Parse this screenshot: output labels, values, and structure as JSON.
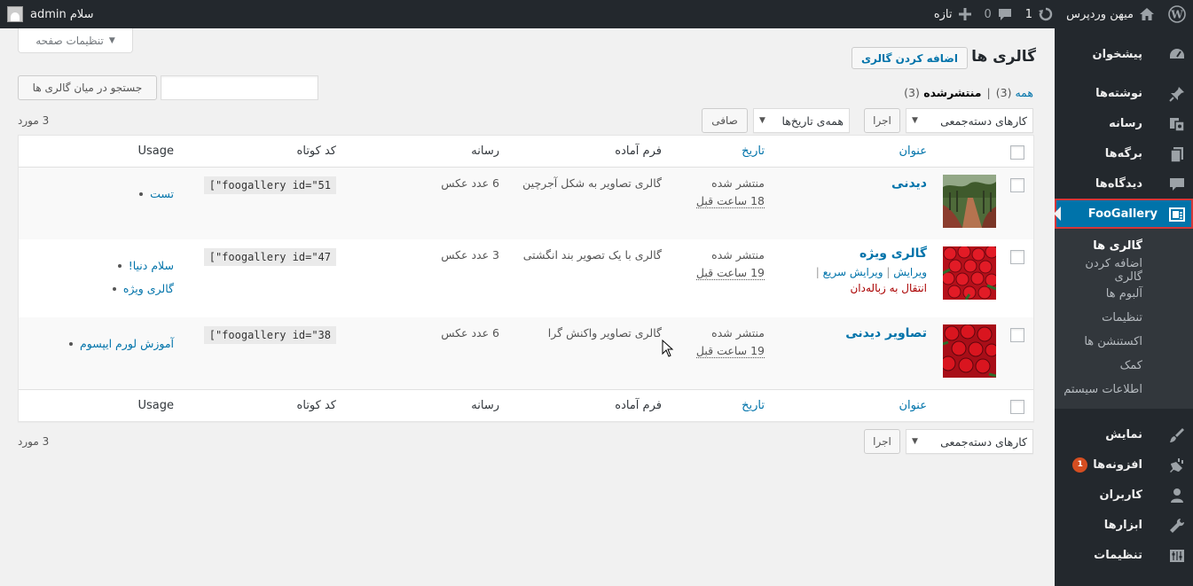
{
  "adminbar": {
    "site_name": "میهن وردپرس",
    "updates_count": "1",
    "comments_count": "0",
    "new_label": "تازه",
    "howdy": "سلام admin"
  },
  "sidebar": {
    "items_top": [
      {
        "label": "پیشخوان",
        "icon": "dashboard-icon"
      }
    ],
    "items": [
      {
        "label": "نوشته‌ها",
        "icon": "pin-icon"
      },
      {
        "label": "رسانه",
        "icon": "media-icon"
      },
      {
        "label": "برگه‌ها",
        "icon": "page-icon"
      },
      {
        "label": "دیدگاه‌ها",
        "icon": "comment-icon"
      }
    ],
    "current": {
      "label": "FooGallery",
      "icon": "gallery-icon"
    },
    "submenu": [
      "گالری ها",
      "اضافه کردن گالری",
      "آلبوم ها",
      "تنظیمات",
      "اکستنشن ها",
      "کمک",
      "اطلاعات سیستم"
    ],
    "items_bottom": [
      {
        "label": "نمایش",
        "icon": "brush-icon"
      },
      {
        "label": "افزونه‌ها",
        "icon": "plugin-icon",
        "badge": "1"
      },
      {
        "label": "کاربران",
        "icon": "users-icon"
      },
      {
        "label": "ابزارها",
        "icon": "tools-icon"
      },
      {
        "label": "تنظیمات",
        "icon": "settings-icon"
      }
    ]
  },
  "page": {
    "title": "گالری ها",
    "add_button": "اضافه کردن گالری",
    "screen_options": "تنظیمات صفحه",
    "search_button": "جستجو در میان گالری ها",
    "search_value": "",
    "filter_all": "همه",
    "filter_all_count": "(3)",
    "filter_published": "منتشرشده",
    "filter_published_count": "(3)",
    "bulk_actions": "کارهای دسته‌جمعی",
    "apply": "اجرا",
    "all_dates": "همه‌ی تاریخ‌ها",
    "filter_button": "صافی",
    "items_count": "3 مورد"
  },
  "table": {
    "columns": {
      "title": "عنوان",
      "date": "تاریخ",
      "template": "فرم آماده",
      "media": "رسانه",
      "shortcode": "کد کوتاه",
      "usage": "Usage"
    },
    "rows": [
      {
        "title": "دیدنی",
        "status": "منتشر شده",
        "time": "18 ساعت قبل",
        "template": "گالری تصاویر به شکل آجرچین",
        "media": "6 عدد عکس",
        "shortcode": "[\"foogallery id=\"51",
        "usage": [
          "تست"
        ],
        "thumb": "path"
      },
      {
        "title": "گالری ویژه",
        "status": "منتشر شده",
        "time": "19 ساعت قبل",
        "template": "گالری با یک تصویر بند انگشتی",
        "media": "3 عدد عکس",
        "shortcode": "[\"foogallery id=\"47",
        "usage": [
          "سلام دنیا!",
          "گالری ویژه"
        ],
        "thumb": "roses",
        "actions": {
          "edit": "ویرایش",
          "quick_edit": "ویرایش سریع",
          "trash": "انتقال به زباله‌دان"
        }
      },
      {
        "title": "تصاویر دیدنی",
        "status": "منتشر شده",
        "time": "19 ساعت قبل",
        "template": "گالری تصاویر واکنش گرا",
        "media": "6 عدد عکس",
        "shortcode": "[\"foogallery id=\"38",
        "usage": [
          "آموزش لورم ایپسوم"
        ],
        "thumb": "roses"
      }
    ]
  }
}
